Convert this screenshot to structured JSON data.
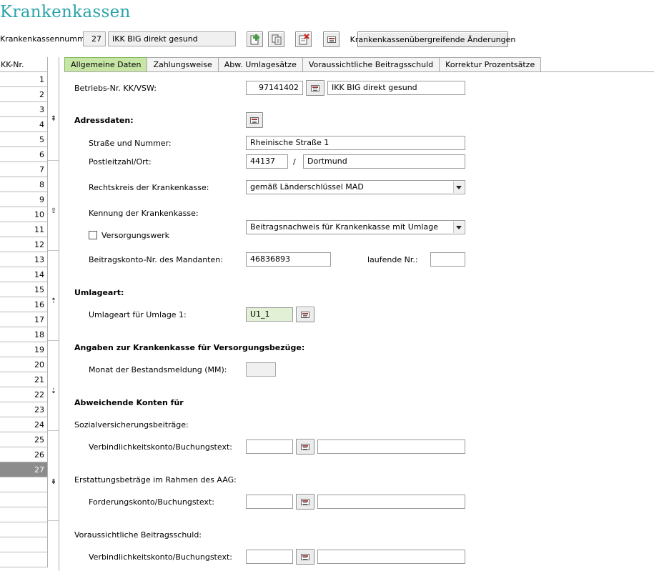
{
  "title": "Krankenkassen",
  "topbar": {
    "number_label": "Krankenkassennummer:",
    "number_value": "27",
    "name_value": "IKK BIG direkt gesund",
    "changes_button": "Krankenkassenübergreifende Änderungen",
    "icons": [
      "add-icon",
      "copy-icon",
      "delete-icon",
      "card-icon"
    ]
  },
  "grid": {
    "header": "KK-Nr.",
    "rows": [
      "1",
      "2",
      "3",
      "4",
      "5",
      "6",
      "7",
      "8",
      "9",
      "10",
      "11",
      "12",
      "13",
      "14",
      "15",
      "16",
      "17",
      "18",
      "19",
      "20",
      "21",
      "22",
      "23",
      "24",
      "25",
      "26",
      "27"
    ],
    "selected": "27"
  },
  "tabs": [
    {
      "label": "Allgemeine Daten",
      "active": true
    },
    {
      "label": "Zahlungsweise"
    },
    {
      "label": "Abw. Umlagesätze"
    },
    {
      "label": "Voraussichtliche Beitragsschuld"
    },
    {
      "label": "Korrektur Prozentsätze"
    }
  ],
  "form": {
    "betriebs_label": "Betriebs-Nr. KK/VSW:",
    "betriebs_value": "97141402",
    "betriebs_name": "IKK BIG direkt gesund",
    "adress_header": "Adressdaten:",
    "strasse_label": "Straße und Nummer:",
    "strasse_value": "Rheinische Straße 1",
    "plz_label": "Postleitzahl/Ort:",
    "plz_value": "44137",
    "slash": "/",
    "ort_value": "Dortmund",
    "rechtskreis_label": "Rechtskreis der Krankenkasse:",
    "rechtskreis_value": "gemäß Länderschlüssel MAD",
    "kennung_label": "Kennung der Krankenkasse:",
    "kennung_value": "Beitragsnachweis für Krankenkasse mit Umlage",
    "versorgungswerk_label": "Versorgungswerk",
    "beitragskonto_label": "Beitragskonto-Nr. des Mandanten:",
    "beitragskonto_value": "46836893",
    "laufende_label": "laufende Nr.:",
    "laufende_value": "",
    "umlage_header": "Umlageart:",
    "umlage1_label": "Umlageart für Umlage 1:",
    "umlage1_value": "U1_1",
    "versorgung_header": "Angaben zur Krankenkasse für Versorgungsbezüge:",
    "monat_label": "Monat der Bestandsmeldung (MM):",
    "monat_value": "",
    "konten_header": "Abweichende Konten für",
    "sozial_label": "Sozialversicherungsbeiträge:",
    "verb1_label": "Verbindlichkeitskonto/Buchungstext:",
    "erstattung_label": "Erstattungsbeträge im Rahmen des AAG:",
    "forderung_label": "Forderungskonto/Buchungstext:",
    "voraus_label": "Voraussichtliche Beitragsschuld:",
    "verb2_label": "Verbindlichkeitskonto/Buchungstext:"
  }
}
